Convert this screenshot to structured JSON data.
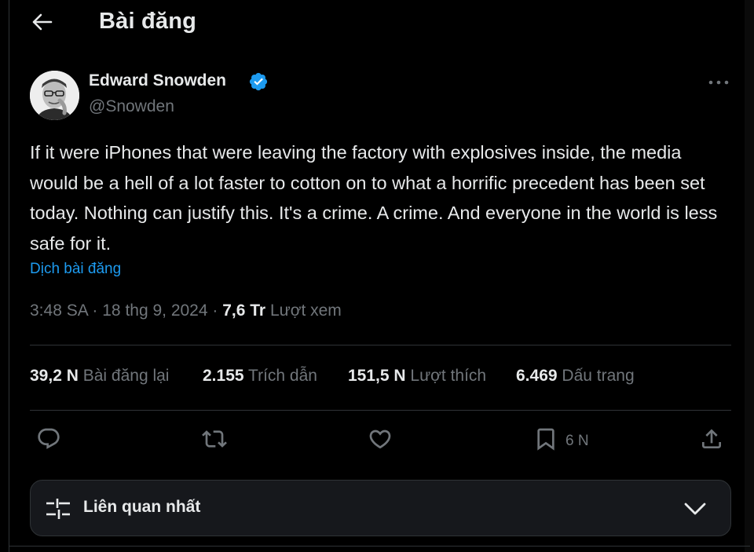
{
  "header": {
    "title": "Bài đăng"
  },
  "author": {
    "name": "Edward Snowden",
    "handle": "@Snowden"
  },
  "tweet": {
    "text": "If it were iPhones that were leaving the factory with explosives inside, the media would be a hell of a lot faster to cotton on to what a horrific precedent has been set today. Nothing can justify this. It's a crime. A crime. And everyone in the world is less safe for it.",
    "translate_label": "Dịch bài đăng",
    "time": "3:48 SA",
    "date": "18 thg 9, 2024",
    "separator": "·",
    "views_count": "7,6 Tr",
    "views_label": "Lượt xem"
  },
  "stats": [
    {
      "count": "39,2 N",
      "label": "Bài đăng lại"
    },
    {
      "count": "2.155",
      "label": "Trích dẫn"
    },
    {
      "count": "151,5 N",
      "label": "Lượt thích"
    },
    {
      "count": "6.469",
      "label": "Dấu trang"
    }
  ],
  "actions": {
    "icons": [
      "reply-icon",
      "repost-icon",
      "like-icon",
      "bookmark-icon",
      "share-icon"
    ],
    "bookmark_count": "6 N"
  },
  "sort": {
    "label": "Liên quan nhất"
  },
  "colors": {
    "accent": "#1d9bf0",
    "muted": "#71767b",
    "text": "#e7e9ea",
    "background": "#000000",
    "border": "#2f3336"
  }
}
